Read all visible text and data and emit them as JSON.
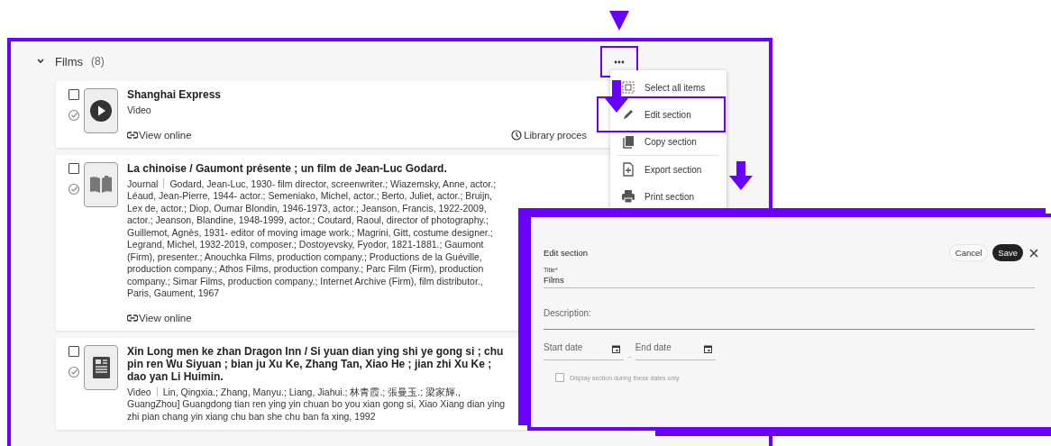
{
  "section": {
    "title": "Films",
    "count": "(8)",
    "expanded": true,
    "more_highlighted": true
  },
  "items": [
    {
      "kind": "video",
      "title": "Shanghai Express",
      "type": "Video",
      "link": "View online",
      "status": "Library proces",
      "checked": false
    },
    {
      "kind": "book",
      "title": "La chinoise / Gaumont présente ; un film de Jean-Luc Godard.",
      "type": "Journal",
      "details": "Godard, Jean-Luc, 1930- film director, screenwriter.; Wiazemsky, Anne, actor.; Léaud, Jean-Pierre, 1944- actor.; Semeniako, Michel, actor.; Berto, Juliet, actor.; Bruijn, Lex de, actor.; Diop, Oumar Blondin, 1946-1973, actor.; Jeanson, Francis, 1922-2009, actor.; Jeanson, Blandine, 1948-1999, actor.; Coutard, Raoul, director of photography.; Guillemot, Agnès, 1931- editor of moving image work.; Magrini, Gitt, costume designer.; Legrand, Michel, 1932-2019, composer.; Dostoyevsky, Fyodor, 1821-1881.; Gaumont (Firm), presenter.; Anouchka Films, production company.; Productions de la Guéville, production company.; Athos Films, production company.; Parc Film (Firm), production company.; Simar Films, production company.; Internet Archive (Firm), film distributor., Paris, Gaument, 1967",
      "link": "View online",
      "checked": false
    },
    {
      "kind": "document",
      "title": "Xin Long men ke zhan Dragon Inn / Si yuan dian ying shi ye gong si ; chu pin ren Wu Siyuan ; bian ju Xu Ke, Zhang Tan, Xiao He ; jian zhi Xu Ke ; dao yan Li Huimin.",
      "type": "Video",
      "details": "Lin, Qingxia.; Zhang, Manyu.; Liang, Jiahui.; 林青霞.; 張曼玉.; 梁家輝., GuangZhou] Guangdong tian ren ying yin chuan bo you xian gong si, Xiao Xiang dian ying zhi pian chang yin xiang chu ban she chu ban fa xing, 1992",
      "checked": false
    }
  ],
  "menu": [
    {
      "kind": "select",
      "label": "Select all items",
      "highlighted": false
    },
    {
      "kind": "edit",
      "label": "Edit section",
      "highlighted": true
    },
    {
      "kind": "copy",
      "label": "Copy section",
      "highlighted": false
    },
    {
      "kind": "export",
      "label": "Export section",
      "highlighted": false
    },
    {
      "kind": "print",
      "label": "Print section",
      "highlighted": false
    }
  ],
  "edit_panel": {
    "title": "Edit section",
    "cancel": "Cancel",
    "save": "Save",
    "title_label": "Title*",
    "title_value": "Films",
    "description_placeholder": "Description:",
    "start_placeholder": "Start date",
    "date_separator": "-",
    "end_placeholder": "End date",
    "date_only_label": "Display section during these dates only",
    "date_only_checked": false
  }
}
